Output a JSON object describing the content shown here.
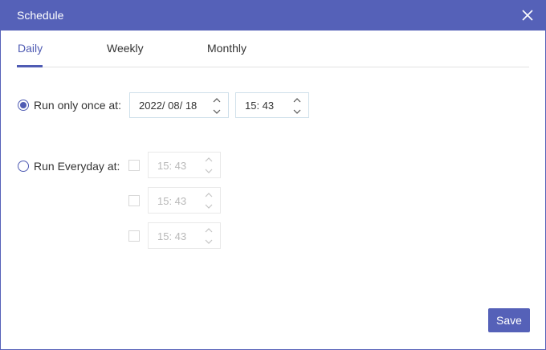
{
  "dialog": {
    "title": "Schedule",
    "close_icon": "close-icon"
  },
  "tabs": [
    {
      "label": "Daily",
      "active": true
    },
    {
      "label": "Weekly",
      "active": false
    },
    {
      "label": "Monthly",
      "active": false
    }
  ],
  "run_once": {
    "label": "Run only once at:",
    "selected": true,
    "date": "2022/ 08/ 18",
    "time": "15: 43"
  },
  "run_everyday": {
    "label": "Run Everyday at:",
    "selected": false,
    "times": [
      {
        "checked": false,
        "time": "15: 43"
      },
      {
        "checked": false,
        "time": "15: 43"
      },
      {
        "checked": false,
        "time": "15: 43"
      }
    ]
  },
  "save_label": "Save",
  "colors": {
    "accent": "#5561b8",
    "active_tab": "#4f5bb3",
    "disabled_text": "#b8b8b8"
  }
}
